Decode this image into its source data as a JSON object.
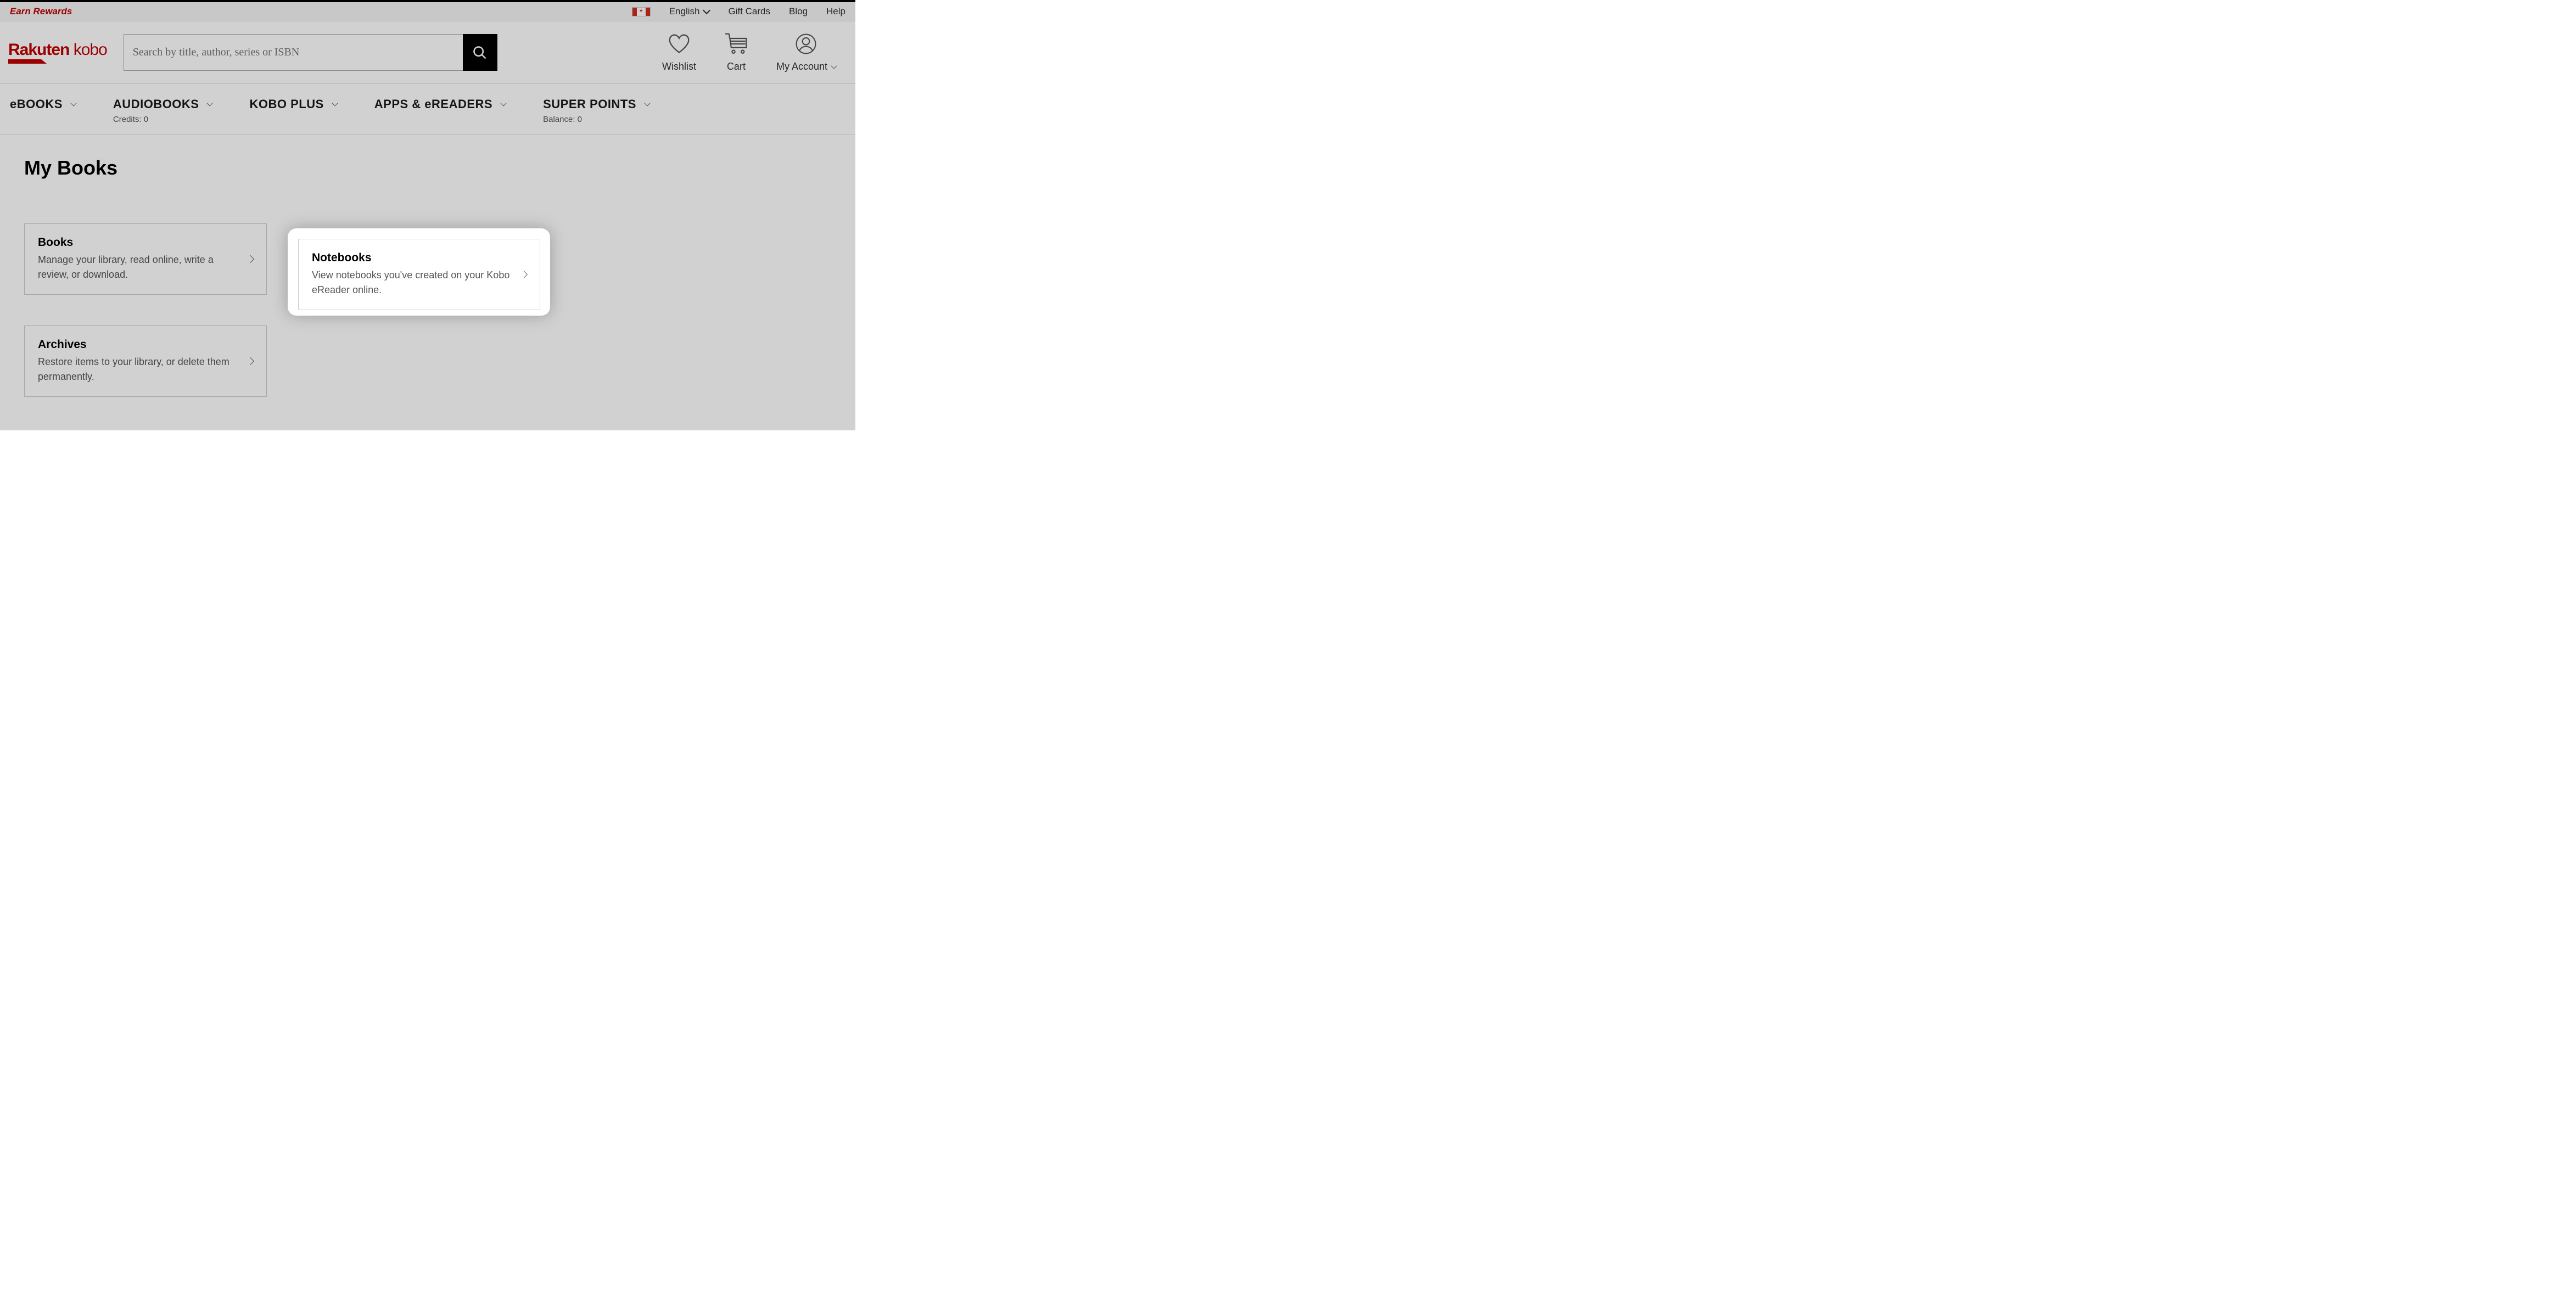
{
  "topbar": {
    "earn_rewards": "Earn Rewards",
    "language": "English",
    "gift_cards": "Gift Cards",
    "blog": "Blog",
    "help": "Help"
  },
  "header": {
    "logo_rakuten": "Rakuten",
    "logo_kobo": "kobo",
    "search_placeholder": "Search by title, author, series or ISBN",
    "wishlist": "Wishlist",
    "cart": "Cart",
    "account": "My Account"
  },
  "nav": {
    "items": [
      {
        "label": "eBOOKS",
        "sub": ""
      },
      {
        "label": "AUDIOBOOKS",
        "sub": "Credits: 0"
      },
      {
        "label": "KOBO PLUS",
        "sub": ""
      },
      {
        "label": "APPS & eREADERS",
        "sub": ""
      },
      {
        "label": "SUPER POINTS",
        "sub": "Balance: 0"
      }
    ]
  },
  "page": {
    "title": "My Books",
    "cards": {
      "books": {
        "title": "Books",
        "desc": "Manage your library, read online, write a review, or download."
      },
      "notebooks": {
        "title": "Notebooks",
        "desc": "View notebooks you've created on your Kobo eReader online."
      },
      "archives": {
        "title": "Archives",
        "desc": "Restore items to your library, or delete them permanently."
      }
    }
  }
}
